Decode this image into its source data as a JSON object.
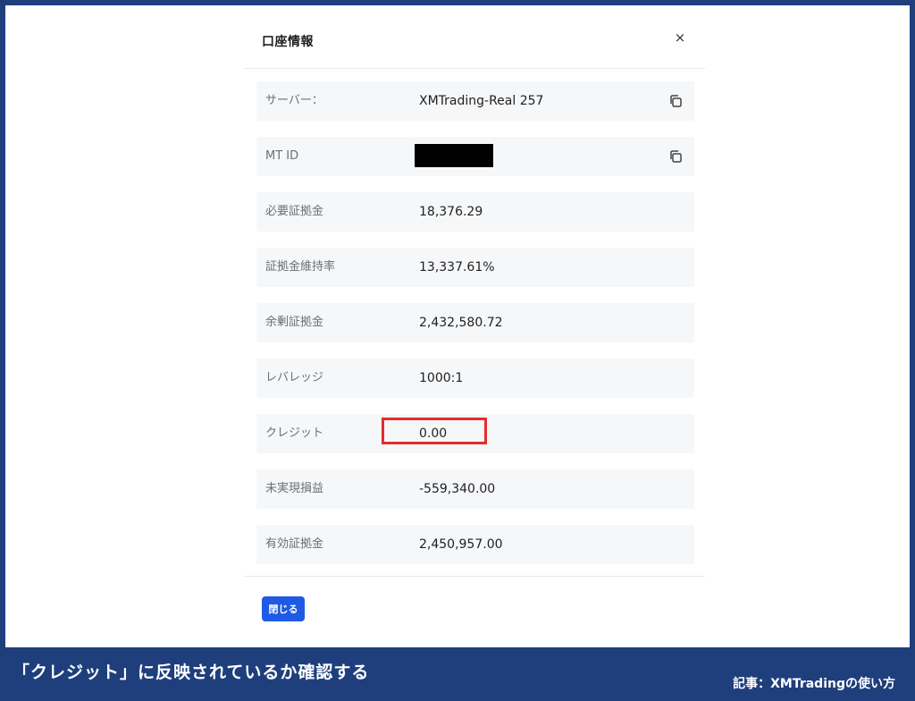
{
  "dialog": {
    "title": "口座情報",
    "close_symbol": "×",
    "close_button_label": "閉じる"
  },
  "rows": [
    {
      "label": "サーバー：",
      "value": "XMTrading-Real 257",
      "icon": "copy-icon"
    },
    {
      "label": "MT ID",
      "value": "",
      "redacted": true,
      "icon": "copy-icon"
    },
    {
      "label": "必要証拠金",
      "value": "18,376.29"
    },
    {
      "label": "証拠金維持率",
      "value": "13,337.61%"
    },
    {
      "label": "余剰証拠金",
      "value": "2,432,580.72"
    },
    {
      "label": "レバレッジ",
      "value": "1000:1"
    },
    {
      "label": "クレジット",
      "value": "0.00",
      "highlighted": true
    },
    {
      "label": "未実現損益",
      "value": "-559,340.00"
    },
    {
      "label": "有効証拠金",
      "value": "2,450,957.00"
    }
  ],
  "caption": {
    "main": "「クレジット」に反映されているか確認する",
    "source": "記事：XMTradingの使い方"
  },
  "colors": {
    "frame_background": "#1f3e7c",
    "button_primary": "#1e5ae3",
    "highlight": "#e32c2c",
    "row_background": "#f6f7f9"
  }
}
